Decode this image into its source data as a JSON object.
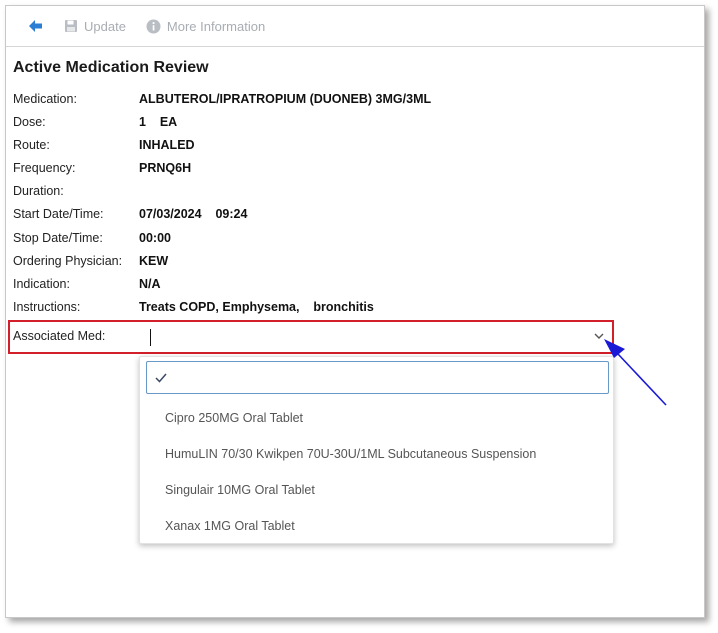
{
  "toolbar": {
    "back_icon": "back-arrow-icon",
    "update_label": "Update",
    "update_icon": "save-disk-icon",
    "more_info_label": "More Information",
    "more_info_icon": "info-icon"
  },
  "review": {
    "title": "Active Medication Review",
    "fields": [
      {
        "label": "Medication:",
        "value": "ALBUTEROL/IPRATROPIUM (DUONEB) 3MG/3ML"
      },
      {
        "label": "Dose:",
        "value": "1    EA"
      },
      {
        "label": "Route:",
        "value": "INHALED"
      },
      {
        "label": "Frequency:",
        "value": "PRNQ6H"
      },
      {
        "label": "Duration:",
        "value": ""
      },
      {
        "label": "Start Date/Time:",
        "value": "07/03/2024    09:24"
      },
      {
        "label": "Stop Date/Time:",
        "value": "00:00"
      },
      {
        "label": "Ordering Physician:",
        "value": "KEW"
      },
      {
        "label": "Indication:",
        "value": "N/A"
      },
      {
        "label": "Instructions:",
        "value": "Treats COPD, Emphysema,    bronchitis"
      }
    ]
  },
  "associated_med": {
    "label": "Associated Med:",
    "value": "",
    "options": [
      {
        "label": ""
      },
      {
        "label": "Cipro 250MG Oral Tablet"
      },
      {
        "label": "HumuLIN 70/30 Kwikpen 70U-30U/1ML Subcutaneous Suspension"
      },
      {
        "label": "Singulair 10MG Oral Tablet"
      },
      {
        "label": "Xanax 1MG Oral Tablet"
      }
    ]
  },
  "colors": {
    "highlight_box": "#d21f2a",
    "annotation_arrow": "#1a1ad6",
    "selected_option_border": "#6a98c9",
    "back_icon": "#2a7fd4"
  }
}
